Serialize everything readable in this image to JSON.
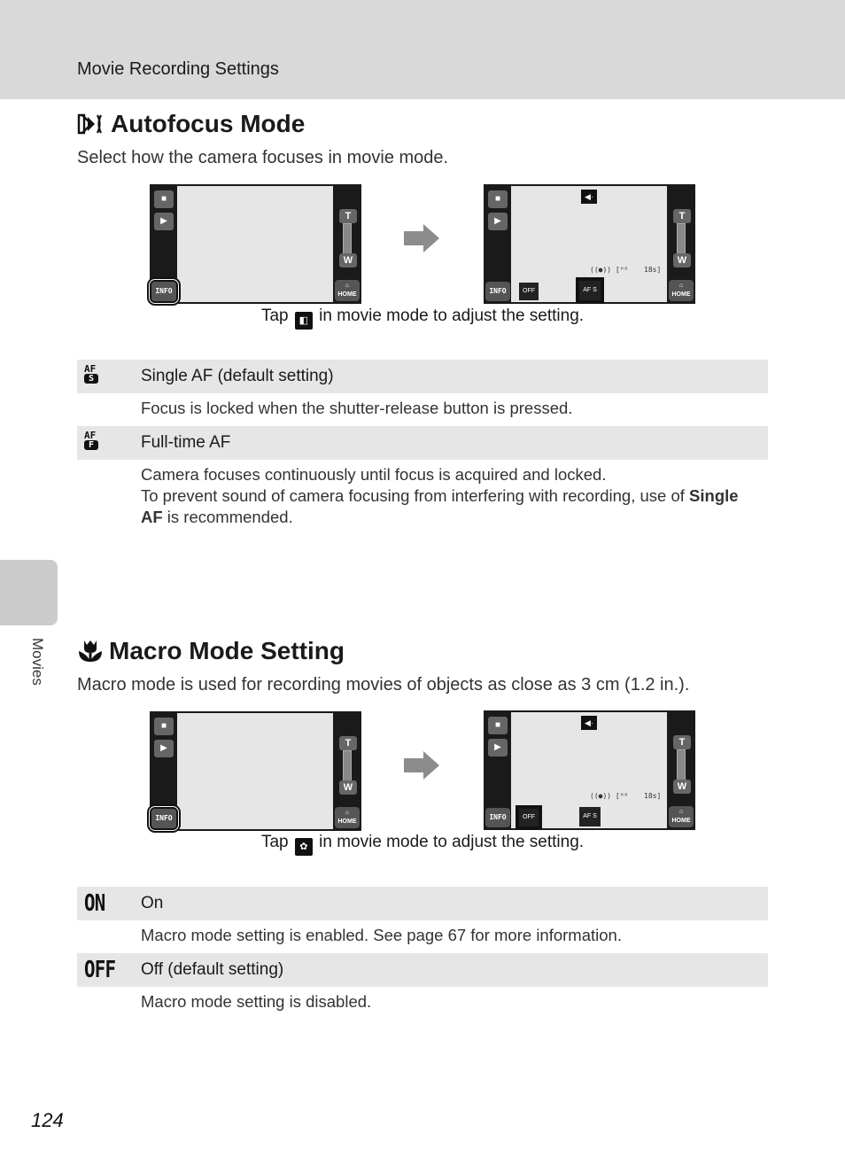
{
  "header": {
    "title": "Movie Recording Settings"
  },
  "side_tab": {
    "label": "Movies"
  },
  "sections": [
    {
      "title": "Autofocus Mode",
      "icon": "autofocus-icon",
      "subtitle": "Select how the camera focuses in movie mode.",
      "caption": {
        "before": "Tap",
        "icon_glyph": "◧",
        "after": "in movie mode to adjust the setting."
      },
      "options": [
        {
          "symbol_top": "AF",
          "symbol_bottom": "S",
          "label": "Single AF (default setting)",
          "desc_lines": [
            "Focus is locked when the shutter-release button is pressed."
          ]
        },
        {
          "symbol_top": "AF",
          "symbol_bottom": "F",
          "label": "Full-time AF",
          "desc_lines": [
            "Camera focuses continuously until focus is acquired and locked."
          ],
          "desc_extra": {
            "before": "To prevent sound of camera focusing from interfering with recording, use of ",
            "bold": "Single AF",
            "after": " is recommended."
          }
        }
      ]
    },
    {
      "title": "Macro Mode Setting",
      "icon": "macro-tulip-icon",
      "subtitle": "Macro mode is used for recording movies of objects as close as 3 cm (1.2 in.).",
      "caption": {
        "before": "Tap",
        "icon_glyph": "✿",
        "after": "in movie mode to adjust the setting."
      },
      "options": [
        {
          "symbol": "ON",
          "label": "On",
          "desc": "Macro mode setting is enabled. See page 67 for more information."
        },
        {
          "symbol": "OFF",
          "label": "Off (default setting)",
          "desc": "Macro mode setting is disabled."
        }
      ]
    }
  ],
  "screen": {
    "info": "INFO",
    "home": "HOME",
    "zoom_t": "T",
    "zoom_w": "W",
    "cam_glyph": "■",
    "play_glyph": "▶",
    "status_left": "((●)) [ᴴᴰ",
    "status_right": "18s]",
    "macro_label": "OFF",
    "af_label": "AF S",
    "top_icon": "◀·"
  },
  "page_number": "124"
}
